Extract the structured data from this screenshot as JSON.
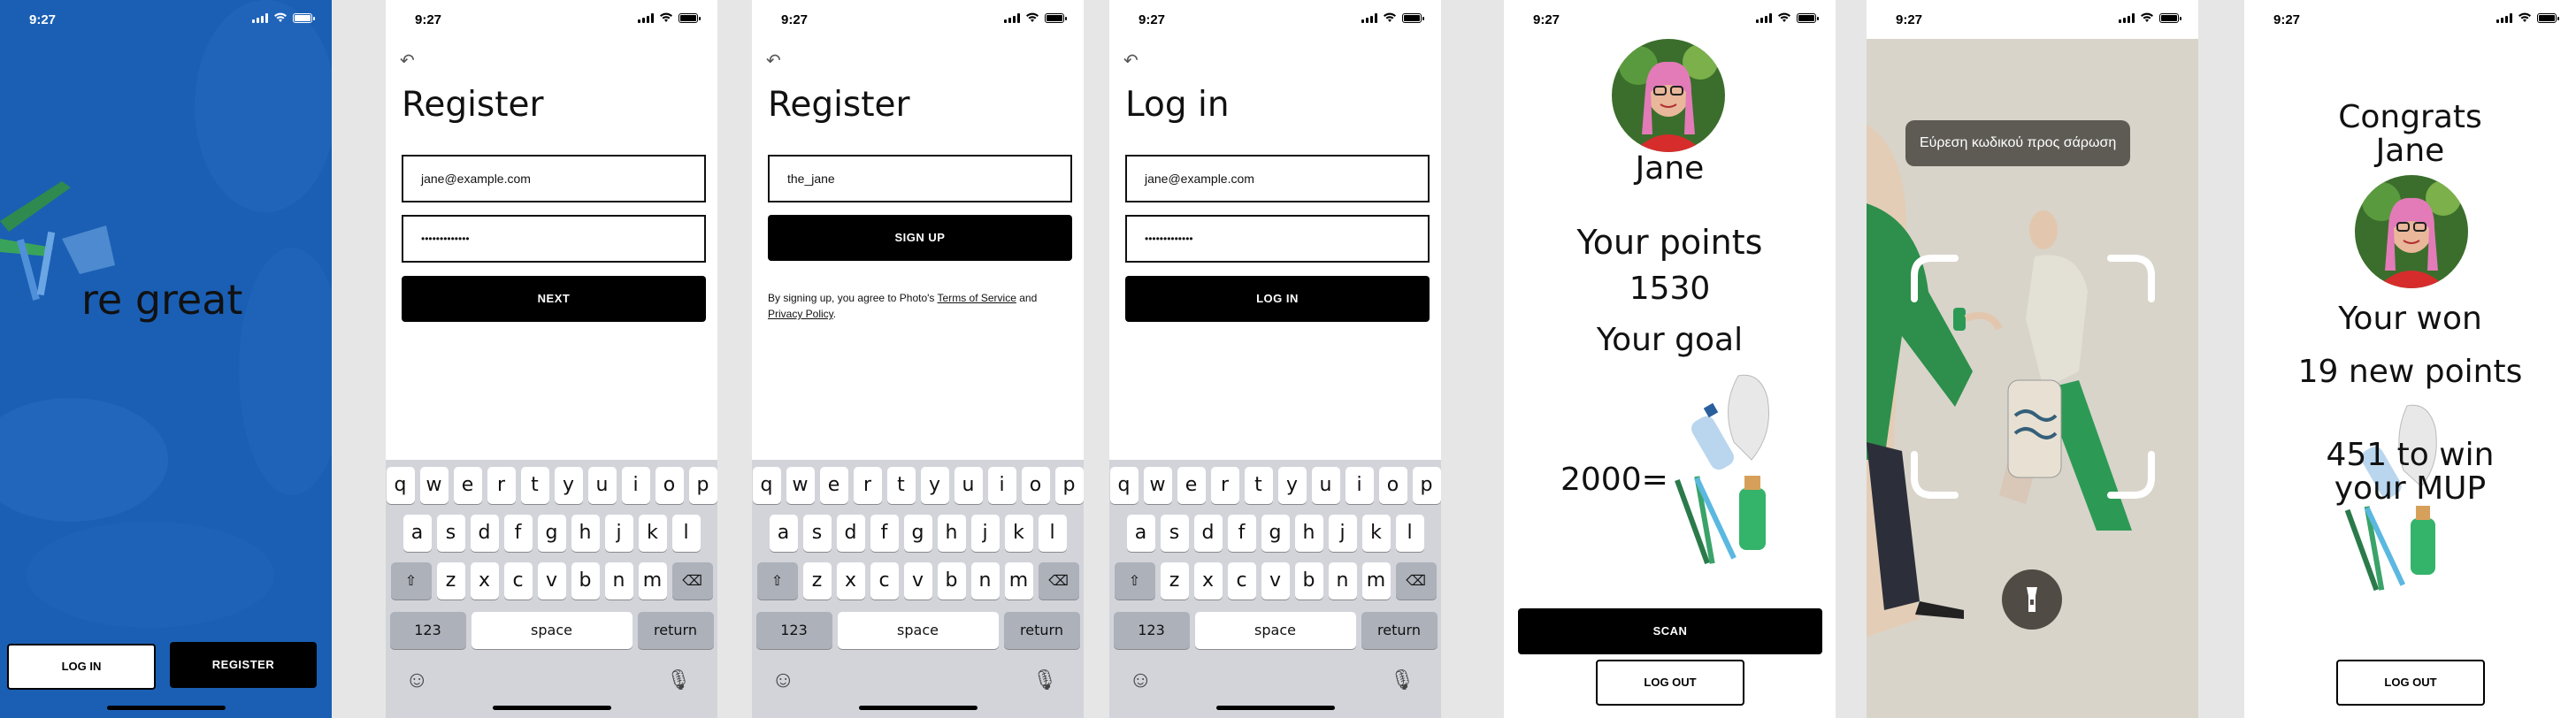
{
  "status": {
    "time": "9:27"
  },
  "screen1": {
    "hero_text": "re great",
    "login_label": "LOG IN",
    "register_label": "REGISTER",
    "bg_color": "#1a5fb4"
  },
  "screen2": {
    "title": "Register",
    "email_value": "jane@example.com",
    "password_value": "•••••••••••••",
    "next_label": "NEXT"
  },
  "screen3": {
    "title": "Register",
    "username_value": "the_jane",
    "signup_label": "SIGN UP",
    "terms_prefix": "By signing up, you agree to Photo's ",
    "terms_link": "Terms of Service",
    "terms_and": " and",
    "privacy_link": "Privacy Policy",
    "terms_end": "."
  },
  "screen4": {
    "title": "Log in",
    "email_value": "jane@example.com",
    "password_value": "•••••••••••••",
    "login_label": "LOG IN"
  },
  "keyboard": {
    "row1": [
      "q",
      "w",
      "e",
      "r",
      "t",
      "y",
      "u",
      "i",
      "o",
      "p"
    ],
    "row2": [
      "a",
      "s",
      "d",
      "f",
      "g",
      "h",
      "j",
      "k",
      "l"
    ],
    "row3": [
      "z",
      "x",
      "c",
      "v",
      "b",
      "n",
      "m"
    ],
    "num_label": "123",
    "space_label": "space",
    "return_label": "return"
  },
  "screen5": {
    "name": "Jane",
    "points_label": "Your points",
    "points_value": "1530",
    "goal_label": "Your goal",
    "goal_value": "2000=",
    "scan_label": "SCAN",
    "logout_label": "LOG OUT"
  },
  "screen6": {
    "tooltip": "Εύρεση κωδικού προς σάρωση",
    "flashlight_icon": "flashlight-icon"
  },
  "screen7": {
    "congrats": "Congrats",
    "name": "Jane",
    "won_label": "Your won",
    "new_points": "19 new points",
    "to_win_line1": "451 to win",
    "to_win_line2": "your MUP",
    "logout_label": "LOG OUT"
  }
}
